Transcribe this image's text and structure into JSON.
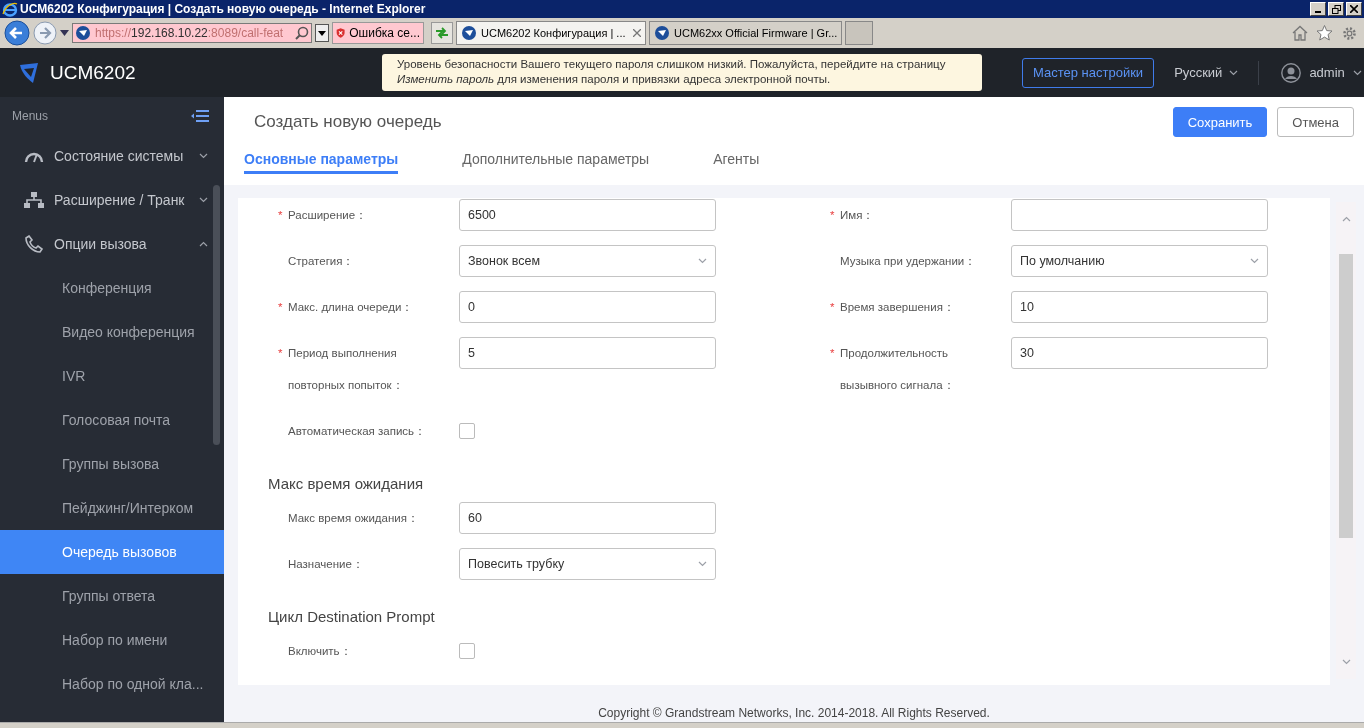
{
  "browser": {
    "title": "UCM6202 Конфигурация | Создать новую очередь - Internet Explorer",
    "address": {
      "scheme": "https://",
      "host": "192.168.10.22",
      "rest": ":8089/call-feat"
    },
    "error_label": "Ошибка се...",
    "tabs": [
      {
        "label": "UCM6202 Конфигурация | ...",
        "selected": true
      },
      {
        "label": "UCM62xx Official Firmware | Gr...",
        "selected": false
      }
    ]
  },
  "header": {
    "product": "UCM6202",
    "notice": [
      "Уровень безопасности Вашего текущего пароля слишком низкий. Пожалуйста, перейдите на страницу",
      "*Изменить пароль* для изменения пароля и привязки адреса электронной почты."
    ],
    "wizard_button": "Мастер настройки",
    "language": "Русский",
    "user": "admin"
  },
  "sidebar": {
    "title": "Menus",
    "items": [
      {
        "label": "Состояние системы",
        "expanded": false
      },
      {
        "label": "Расширение / Транк",
        "expanded": false
      },
      {
        "label": "Опции вызова",
        "expanded": true,
        "children": [
          {
            "label": "Конференция",
            "selected": false
          },
          {
            "label": "Видео конференция",
            "selected": false
          },
          {
            "label": "IVR",
            "selected": false
          },
          {
            "label": "Голосовая почта",
            "selected": false
          },
          {
            "label": "Группы вызова",
            "selected": false
          },
          {
            "label": "Пейджинг/Интерком",
            "selected": false
          },
          {
            "label": "Очередь вызовов",
            "selected": true
          },
          {
            "label": "Группы ответа",
            "selected": false
          },
          {
            "label": "Набор по имени",
            "selected": false
          },
          {
            "label": "Набор по одной кла...",
            "selected": false
          }
        ]
      }
    ]
  },
  "page": {
    "title": "Создать новую очередь",
    "buttons": [
      {
        "label": "Сохранить",
        "kind": "primary"
      },
      {
        "label": "Отмена",
        "kind": "default"
      }
    ],
    "tabs": [
      {
        "label": "Основные параметры",
        "selected": true
      },
      {
        "label": "Дополнительные параметры",
        "selected": false
      },
      {
        "label": "Агенты",
        "selected": false
      }
    ],
    "sections": [
      {
        "kind": "grid",
        "fields": [
          {
            "label": "Расширение：",
            "required_mark": "*",
            "kind": "input",
            "value": "6500"
          },
          {
            "label": "Имя：",
            "required_mark": "*",
            "kind": "input"
          },
          {
            "label": "Стратегия：",
            "kind": "select",
            "value": "Звонок всем"
          },
          {
            "label": "Музыка при удержании：",
            "kind": "select",
            "value": "По умолчанию"
          },
          {
            "label": "Макс. длина очереди：",
            "required_mark": "*",
            "kind": "input",
            "value": "0"
          },
          {
            "label": "Время завершения：",
            "required_mark": "*",
            "kind": "input",
            "value": "10"
          },
          {
            "label": "Период выполнения повторных попыток：",
            "required_mark": "*",
            "kind": "input",
            "value": "5"
          },
          {
            "label": "Продолжительность вызывного сигнала：",
            "required_mark": "*",
            "kind": "input",
            "value": "30"
          },
          {
            "label": "Автоматическая запись：",
            "kind": "checkbox",
            "checked": false
          }
        ]
      },
      {
        "title": "Макс время ожидания",
        "kind": "list",
        "fields": [
          {
            "label": "Макс время ожидания：",
            "kind": "input",
            "value": "60"
          },
          {
            "label": "Назначение：",
            "kind": "select",
            "value": "Повесить трубку"
          }
        ]
      },
      {
        "title": "Цикл Destination Prompt",
        "kind": "list",
        "fields": [
          {
            "label": "Включить：",
            "kind": "checkbox",
            "checked": false
          }
        ]
      }
    ]
  },
  "footer": "Copyright © Grandstream Networks, Inc. 2014-2018. All Rights Reserved."
}
